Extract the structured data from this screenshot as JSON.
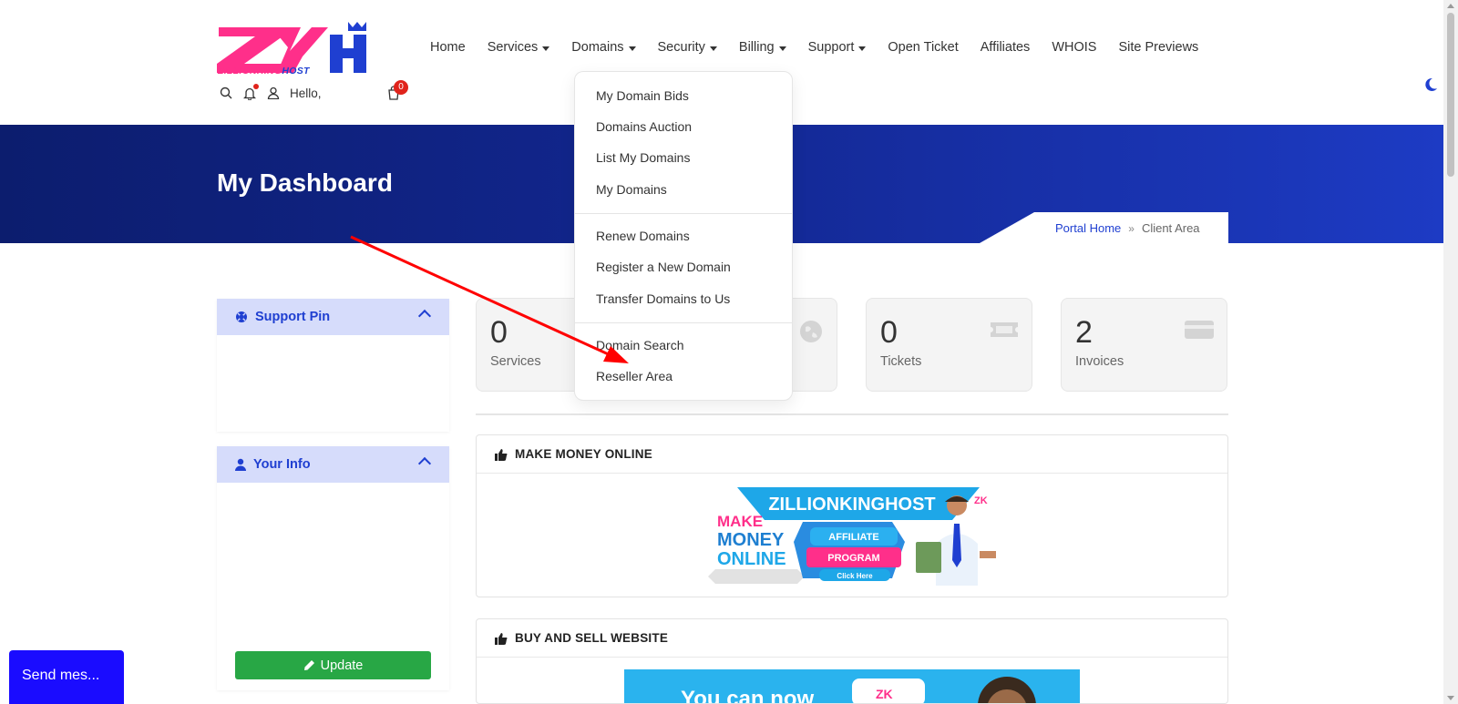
{
  "brand": {
    "name_part1": "ZILLIONKING",
    "name_part2": "HOST"
  },
  "nav": [
    {
      "label": "Home",
      "caret": false
    },
    {
      "label": "Services",
      "caret": true
    },
    {
      "label": "Domains",
      "caret": true
    },
    {
      "label": "Security",
      "caret": true
    },
    {
      "label": "Billing",
      "caret": true
    },
    {
      "label": "Support",
      "caret": true
    },
    {
      "label": "Open Ticket",
      "caret": false
    },
    {
      "label": "Affiliates",
      "caret": false
    },
    {
      "label": "WHOIS",
      "caret": false
    },
    {
      "label": "Site Previews",
      "caret": false
    }
  ],
  "util": {
    "hello": "Hello,",
    "cart_count": "0"
  },
  "banner": {
    "title": "My Dashboard"
  },
  "breadcrumb": {
    "home": "Portal Home",
    "current": "Client Area"
  },
  "sidebar": {
    "support_pin": {
      "title": "Support Pin"
    },
    "your_info": {
      "title": "Your Info",
      "update_label": "Update"
    }
  },
  "stats": [
    {
      "value": "0",
      "label": "Services"
    },
    {
      "value": "0",
      "label": "Tickets"
    },
    {
      "value": "2",
      "label": "Invoices"
    }
  ],
  "cards": {
    "make_money": {
      "title": "MAKE MONEY ONLINE"
    },
    "buy_sell": {
      "title": "BUY AND SELL WEBSITE"
    }
  },
  "promo": {
    "brand": "ZILLIONKINGHOST",
    "make": "MAKE",
    "money": "MONEY",
    "online": "ONLINE",
    "affiliate": "AFFILIATE",
    "program": "PROGRAM",
    "click": "Click Here",
    "banner2_text": "You can now"
  },
  "domains_menu": {
    "group1": [
      "My Domain Bids",
      "Domains Auction",
      "List My Domains",
      "My Domains"
    ],
    "group2": [
      "Renew Domains",
      "Register a New Domain",
      "Transfer Domains to Us"
    ],
    "group3": [
      "Domain Search",
      "Reseller Area"
    ]
  },
  "chat": {
    "label": "Send mes..."
  },
  "colors": {
    "accent": "#1f3fd1",
    "brand_pink": "#ff2f8a",
    "banner_dark": "#0c1d6e",
    "success": "#28a745",
    "chat_blue": "#1a0cff",
    "annotation_red": "#ff0000"
  }
}
